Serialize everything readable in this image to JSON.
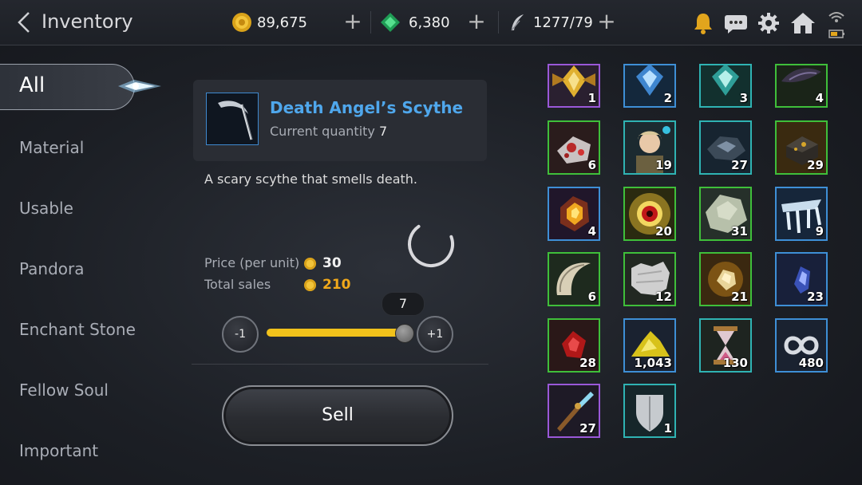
{
  "header": {
    "title": "Inventory",
    "gold": "89,675",
    "gems": "6,380",
    "stamina": "1277/79"
  },
  "sidebar": {
    "active": "All",
    "items": [
      "Material",
      "Usable",
      "Pandora",
      "Enchant Stone",
      "Fellow Soul",
      "Important"
    ]
  },
  "detail": {
    "name": "Death Angel’s Scythe",
    "quantity_label": "Current quantity",
    "quantity": "7",
    "description": "A scary scythe that smells death.",
    "price_label": "Price (per unit)",
    "price": "30",
    "total_label": "Total sales",
    "total": "210",
    "minus_label": "-1",
    "plus_label": "+1",
    "slider_value": "7",
    "slider_fraction": 1.0,
    "sell_label": "Sell"
  },
  "colors": {
    "gold_text": "#f1a91b",
    "name_blue": "#4fa7ec",
    "slider_fill": "#f1c21b",
    "border_green": "#3fbf3a",
    "border_teal": "#2fb3b3",
    "border_blue": "#3e8fd6",
    "border_purple": "#9a58d8"
  },
  "grid": [
    {
      "count": "1",
      "border": "purple",
      "icon": "winged-crest-icon"
    },
    {
      "count": "2",
      "border": "blue",
      "icon": "blue-crest-icon"
    },
    {
      "count": "3",
      "border": "teal",
      "icon": "teal-crest-icon"
    },
    {
      "count": "4",
      "border": "green",
      "icon": "dark-shard-icon"
    },
    {
      "count": "6",
      "border": "green",
      "icon": "red-ore-icon"
    },
    {
      "count": "19",
      "border": "teal",
      "icon": "fellow-portrait-icon"
    },
    {
      "count": "27",
      "border": "teal",
      "icon": "dark-ore-icon"
    },
    {
      "count": "29",
      "border": "green",
      "icon": "gold-ore-block-icon"
    },
    {
      "count": "4",
      "border": "blue",
      "icon": "fire-crystal-icon"
    },
    {
      "count": "20",
      "border": "green",
      "icon": "red-orb-icon"
    },
    {
      "count": "31",
      "border": "green",
      "icon": "stone-fragment-icon"
    },
    {
      "count": "9",
      "border": "blue",
      "icon": "ice-claw-icon"
    },
    {
      "count": "6",
      "border": "green",
      "icon": "horn-icon"
    },
    {
      "count": "12",
      "border": "green",
      "icon": "fur-pelt-icon"
    },
    {
      "count": "21",
      "border": "green",
      "icon": "amber-gem-icon"
    },
    {
      "count": "23",
      "border": "blue",
      "icon": "blue-gem-icon"
    },
    {
      "count": "28",
      "border": "green",
      "icon": "red-crystal-icon"
    },
    {
      "count": "1,043",
      "border": "blue",
      "icon": "gold-powder-icon"
    },
    {
      "count": "130",
      "border": "teal",
      "icon": "hourglass-icon"
    },
    {
      "count": "480",
      "border": "blue",
      "icon": "infinity-icon"
    },
    {
      "count": "27",
      "border": "purple",
      "icon": "crystal-dagger-icon"
    },
    {
      "count": "1",
      "border": "teal",
      "icon": "silver-shield-icon"
    }
  ]
}
